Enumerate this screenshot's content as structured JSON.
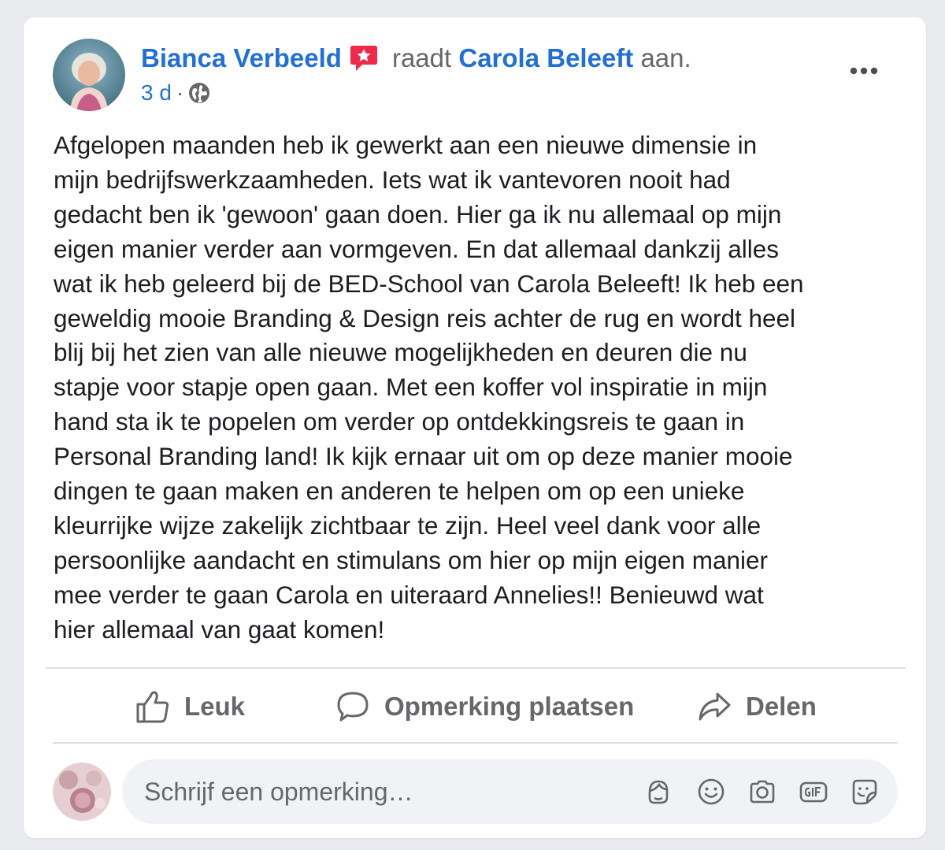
{
  "post": {
    "author": "Bianca Verbeeld",
    "verb": "raadt",
    "target": "Carola Beleeft",
    "suffix": "aan.",
    "time": "3 d",
    "separator": "·",
    "privacy_icon": "globe-icon",
    "more_icon": "more-options-icon",
    "badge_icon": "recommendation-badge-icon",
    "lines": [
      "Afgelopen maanden heb ik gewerkt aan een nieuwe dimensie in",
      "mijn bedrijfswerkzaamheden. Iets wat ik vantevoren nooit had",
      "gedacht ben ik 'gewoon' gaan doen. Hier ga ik nu allemaal op mijn",
      "eigen manier verder aan vormgeven. En dat allemaal dankzij alles",
      "wat ik heb geleerd bij de BED-School van Carola Beleeft! Ik heb een",
      "geweldig mooie Branding & Design reis achter de rug en wordt heel",
      "blij bij het zien van alle nieuwe mogelijkheden en deuren die nu",
      "stapje voor stapje open gaan. Met een koffer vol inspiratie in mijn",
      "hand sta ik te popelen om verder op ontdekkingsreis te gaan in",
      "Personal Branding land! Ik kijk ernaar uit om op deze manier mooie",
      "dingen te gaan maken en anderen te helpen om op een unieke",
      "kleurrijke wijze zakelijk zichtbaar te zijn. Heel veel dank voor alle",
      "persoonlijke aandacht en stimulans om hier op mijn eigen manier",
      "mee verder te gaan Carola en uiteraard Annelies!! Benieuwd wat",
      "hier allemaal van gaat komen!"
    ]
  },
  "actions": {
    "like": "Leuk",
    "comment": "Opmerking plaatsen",
    "share": "Delen"
  },
  "comment_box": {
    "placeholder": "Schrijf een opmerking…",
    "icons": [
      "avatar-sticker-icon",
      "emoji-icon",
      "camera-icon",
      "gif-icon",
      "sticker-icon"
    ]
  },
  "colors": {
    "link": "#216fdb",
    "secondary_text": "#65676b",
    "body_text": "#1c1e21",
    "badge": "#f02849",
    "background": "#e9ebee"
  }
}
